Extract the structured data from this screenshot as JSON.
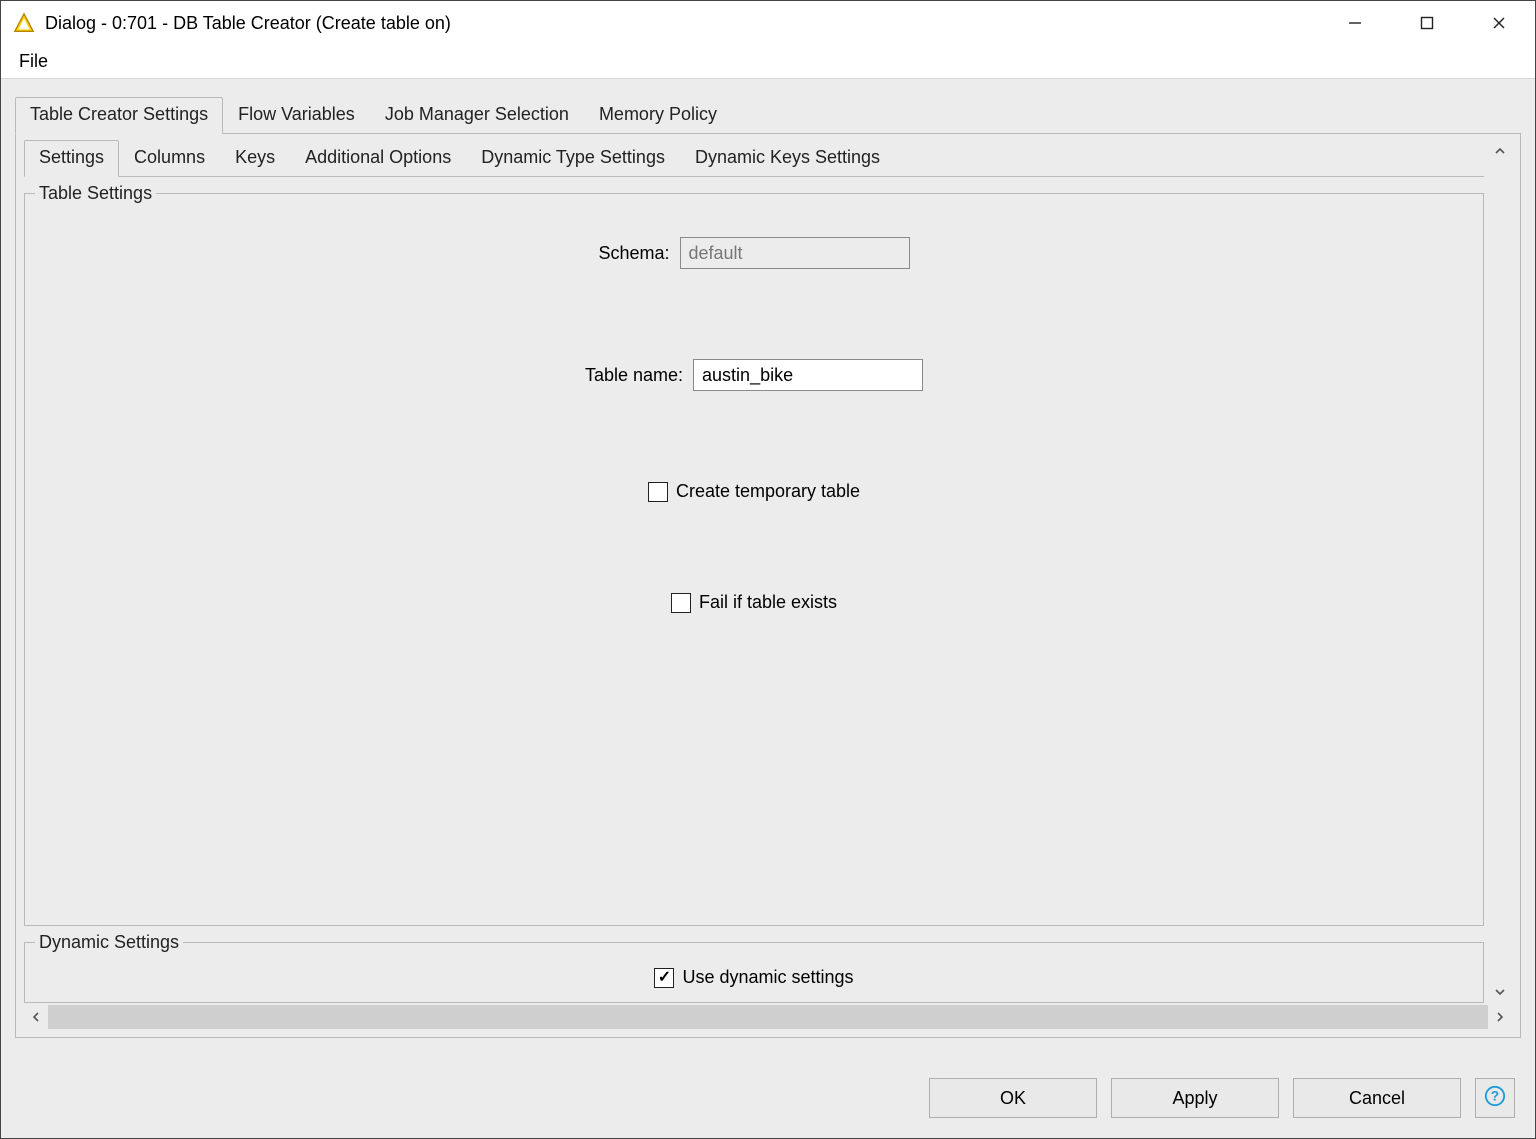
{
  "window": {
    "title": "Dialog - 0:701 - DB Table Creator (Create table on)"
  },
  "menubar": {
    "file": "File"
  },
  "outer_tabs": [
    "Table Creator Settings",
    "Flow Variables",
    "Job Manager Selection",
    "Memory Policy"
  ],
  "inner_tabs": [
    "Settings",
    "Columns",
    "Keys",
    "Additional Options",
    "Dynamic Type Settings",
    "Dynamic Keys Settings"
  ],
  "groups": {
    "table_settings_legend": "Table Settings",
    "dynamic_settings_legend": "Dynamic Settings"
  },
  "form": {
    "schema_label": "Schema:",
    "schema_value": "default",
    "table_name_label": "Table name:",
    "table_name_value": "austin_bike",
    "create_temp_label": "Create temporary table",
    "create_temp_checked": false,
    "fail_exists_label": "Fail if table exists",
    "fail_exists_checked": false,
    "use_dynamic_label": "Use dynamic settings",
    "use_dynamic_checked": true
  },
  "buttons": {
    "ok": "OK",
    "apply": "Apply",
    "cancel": "Cancel"
  }
}
